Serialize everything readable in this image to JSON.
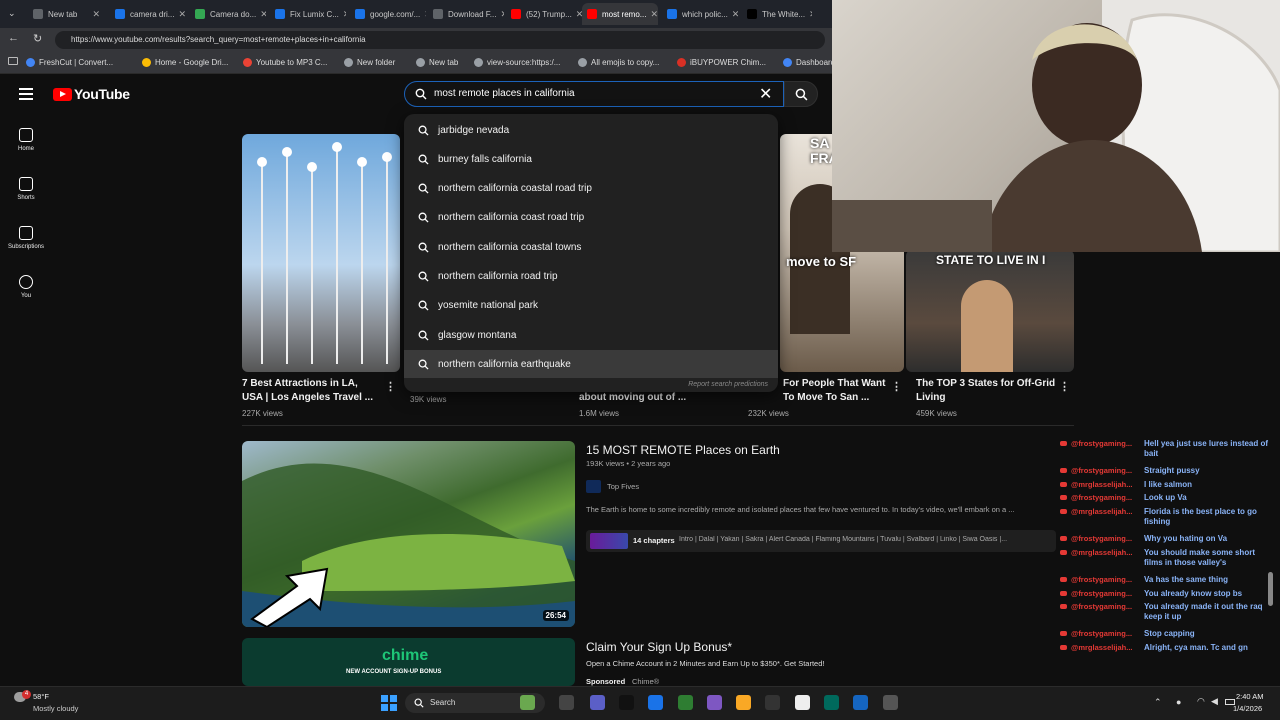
{
  "browser": {
    "tabs": [
      {
        "label": "New tab",
        "color": "#5f6368",
        "active": false
      },
      {
        "label": "camera dri...",
        "color": "#1a73e8",
        "active": false
      },
      {
        "label": "Camera do...",
        "color": "#34a853",
        "active": false
      },
      {
        "label": "Fix Lumix C...",
        "color": "#1a73e8",
        "active": false
      },
      {
        "label": "google.com/...",
        "color": "#1a73e8",
        "active": false
      },
      {
        "label": "Download F...",
        "color": "#5f6368",
        "active": false
      },
      {
        "label": "(52) Trump...",
        "color": "#ff0000",
        "active": false
      },
      {
        "label": "most remo...",
        "color": "#ff0000",
        "active": true
      },
      {
        "label": "which polic...",
        "color": "#1a73e8",
        "active": false
      },
      {
        "label": "The White...",
        "color": "#000000",
        "active": false
      }
    ],
    "url": "https://www.youtube.com/results?search_query=most+remote+places+in+california",
    "bookmarks": [
      {
        "label": "FreshCut | Convert...",
        "color": "#4285f4"
      },
      {
        "label": "Home - Google Dri...",
        "color": "#fbbc05"
      },
      {
        "label": "Youtube to MP3 C...",
        "color": "#ea4335"
      },
      {
        "label": "New folder",
        "color": "#9aa0a6"
      },
      {
        "label": "New tab",
        "color": "#9aa0a6"
      },
      {
        "label": "view-source:https:/...",
        "color": "#9aa0a6"
      },
      {
        "label": "All emojis to copy...",
        "color": "#9aa0a6"
      },
      {
        "label": "iBUYPOWER Chim...",
        "color": "#d93025"
      },
      {
        "label": "Dashboard",
        "color": "#4285f4"
      }
    ]
  },
  "youtube": {
    "logo_text": "YouTube",
    "search_value": "most remote places in california",
    "sidebar": [
      {
        "label": "Home",
        "icon": "home-icon"
      },
      {
        "label": "Shorts",
        "icon": "shorts-icon"
      },
      {
        "label": "Subscriptions",
        "icon": "subscriptions-icon"
      },
      {
        "label": "You",
        "icon": "you-icon"
      }
    ],
    "suggestions": [
      {
        "pre": "",
        "bold": "jarbidge nevada"
      },
      {
        "pre": "",
        "bold": "burney falls california"
      },
      {
        "pre": "",
        "bold": "northern california coastal road trip"
      },
      {
        "pre": "",
        "bold": "northern california coast road trip"
      },
      {
        "pre": "",
        "bold": "northern california coastal towns"
      },
      {
        "pre": "",
        "bold": "northern california road trip"
      },
      {
        "pre": "",
        "bold": "yosemite national park"
      },
      {
        "pre": "",
        "bold": "glasgow montana"
      },
      {
        "pre": "",
        "bold": "northern california earthquake"
      }
    ],
    "report_label": "Report search predictions",
    "shorts_row": [
      {
        "title": "7 Best Attractions in LA, USA | Los Angeles Travel ...",
        "views": "227K views"
      },
      {
        "title": "",
        "views": "39K views"
      },
      {
        "title": "about moving out of ...",
        "views": "1.6M views"
      },
      {
        "title": "For People That Want To Move To San ...",
        "views": "232K views",
        "overlay": "move to SF",
        "overlay_top": "SA FRANC"
      },
      {
        "title": "The TOP 3 States for Off-Grid Living",
        "views": "459K views",
        "overlay": "STATE TO LIVE IN I"
      }
    ],
    "video1": {
      "title": "15 MOST REMOTE Places on Earth",
      "meta": "193K views • 2 years ago",
      "channel": "Top Fives",
      "description": "The Earth is home to some incredibly remote and isolated places that few have ventured to. In today's video, we'll embark on a ...",
      "chapters_label": "14 chapters",
      "chapters": "Intro | Dalal | Yakan | Sakra | Alert Canada | Flaming Mountains | Tuvalu | Svalbard | Linko | Siwa Oasis |...",
      "duration": "26:54"
    },
    "video2": {
      "title": "Claim Your Sign Up Bonus*",
      "description": "Open a Chime Account in 2 Minutes and Earn Up to $350*. Get Started!",
      "sponsored": "Sponsored",
      "advertiser": "Chime®",
      "brand": "chime",
      "brand_sub": "NEW ACCOUNT SIGN-UP BONUS"
    }
  },
  "chat": [
    {
      "user": "@frostygaming...",
      "msg": "Hell yea just use lures instead of bait",
      "ucolor": "#e53935"
    },
    {
      "user": "@frostygaming...",
      "msg": "Straight pussy",
      "ucolor": "#e53935"
    },
    {
      "user": "@mrglasselijah...",
      "msg": "I like salmon",
      "ucolor": "#e53935"
    },
    {
      "user": "@frostygaming...",
      "msg": "Look up Va",
      "ucolor": "#e53935"
    },
    {
      "user": "@mrglasselijah...",
      "msg": "Florida is the best place to go fishing",
      "ucolor": "#e53935"
    },
    {
      "user": "@frostygaming...",
      "msg": "Why you hating on Va",
      "ucolor": "#e53935"
    },
    {
      "user": "@mrglasselijah...",
      "msg": "You should make some short films in those valley's",
      "ucolor": "#e53935"
    },
    {
      "user": "@frostygaming...",
      "msg": "Va has the same thing",
      "ucolor": "#e53935"
    },
    {
      "user": "@frostygaming...",
      "msg": "You already know stop bs",
      "ucolor": "#e53935"
    },
    {
      "user": "@frostygaming...",
      "msg": "You already made it out the raq keep it up",
      "ucolor": "#e53935"
    },
    {
      "user": "@frostygaming...",
      "msg": "Stop capping",
      "ucolor": "#e53935"
    },
    {
      "user": "@mrglasselijah...",
      "msg": "Alright, cya man. Tc and gn",
      "ucolor": "#e53935"
    }
  ],
  "taskbar": {
    "weather_temp": "58°F",
    "weather_desc": "Mostly cloudy",
    "search_label": "Search",
    "time": "2:40 AM",
    "date": "1/4/2026",
    "badge": "4"
  }
}
